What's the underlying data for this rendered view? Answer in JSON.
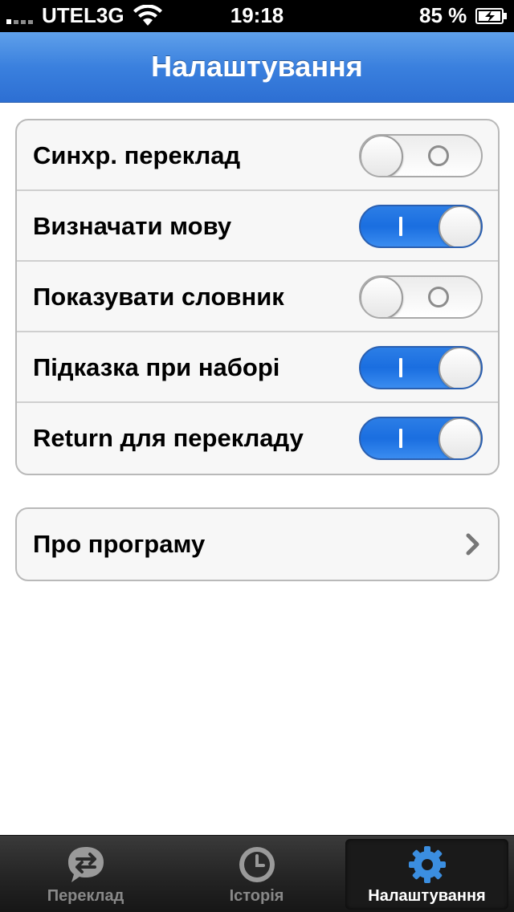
{
  "status_bar": {
    "carrier": "UTEL3G",
    "time": "19:18",
    "battery": "85 %"
  },
  "nav": {
    "title": "Налаштування"
  },
  "settings": {
    "toggles": [
      {
        "label": "Синхр. переклад",
        "on": false
      },
      {
        "label": "Визначати мову",
        "on": true
      },
      {
        "label": "Показувати словник",
        "on": false
      },
      {
        "label": "Підказка при наборі",
        "on": true
      },
      {
        "label": "Return для перекладу",
        "on": true
      }
    ],
    "about_label": "Про програму"
  },
  "tabs": [
    {
      "label": "Переклад",
      "icon": "translate-bubble-icon",
      "selected": false
    },
    {
      "label": "Історія",
      "icon": "clock-icon",
      "selected": false
    },
    {
      "label": "Налаштування",
      "icon": "gear-icon",
      "selected": true
    }
  ],
  "colors": {
    "nav_blue": "#3a80de",
    "switch_on": "#1a6ee0",
    "gear_blue": "#3b8ee0"
  }
}
